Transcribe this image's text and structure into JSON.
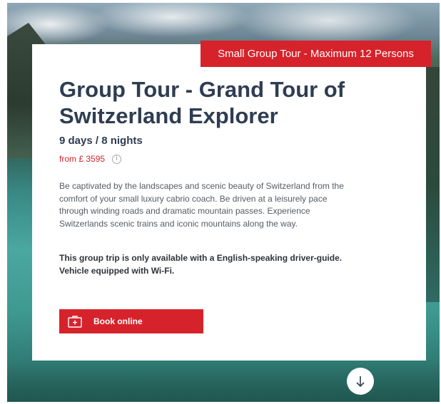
{
  "badge": {
    "text": "Small Group Tour - Maximum 12 Persons"
  },
  "tour": {
    "title": "Group Tour - Grand Tour of Switzerland Explorer",
    "duration": "9 days / 8 nights",
    "price": "from £ 3595",
    "description": "Be captivated by the landscapes and scenic beauty of Switzerland from the comfort of your small luxury cabrio coach. Be driven at a leisurely pace through winding roads and dramatic mountain passes. Experience Switzerlands scenic trains and iconic mountains along the way.",
    "notice": "This group trip is only available with a English-speaking driver-guide. Vehicle equipped with Wi-Fi."
  },
  "actions": {
    "book_label": "Book online"
  },
  "icons": {
    "info": "info-icon",
    "book": "suitcase-plus-icon",
    "scroll": "arrow-down-icon"
  },
  "colors": {
    "accent": "#d6232b",
    "heading": "#2f3d52",
    "body_text": "#555c64"
  }
}
